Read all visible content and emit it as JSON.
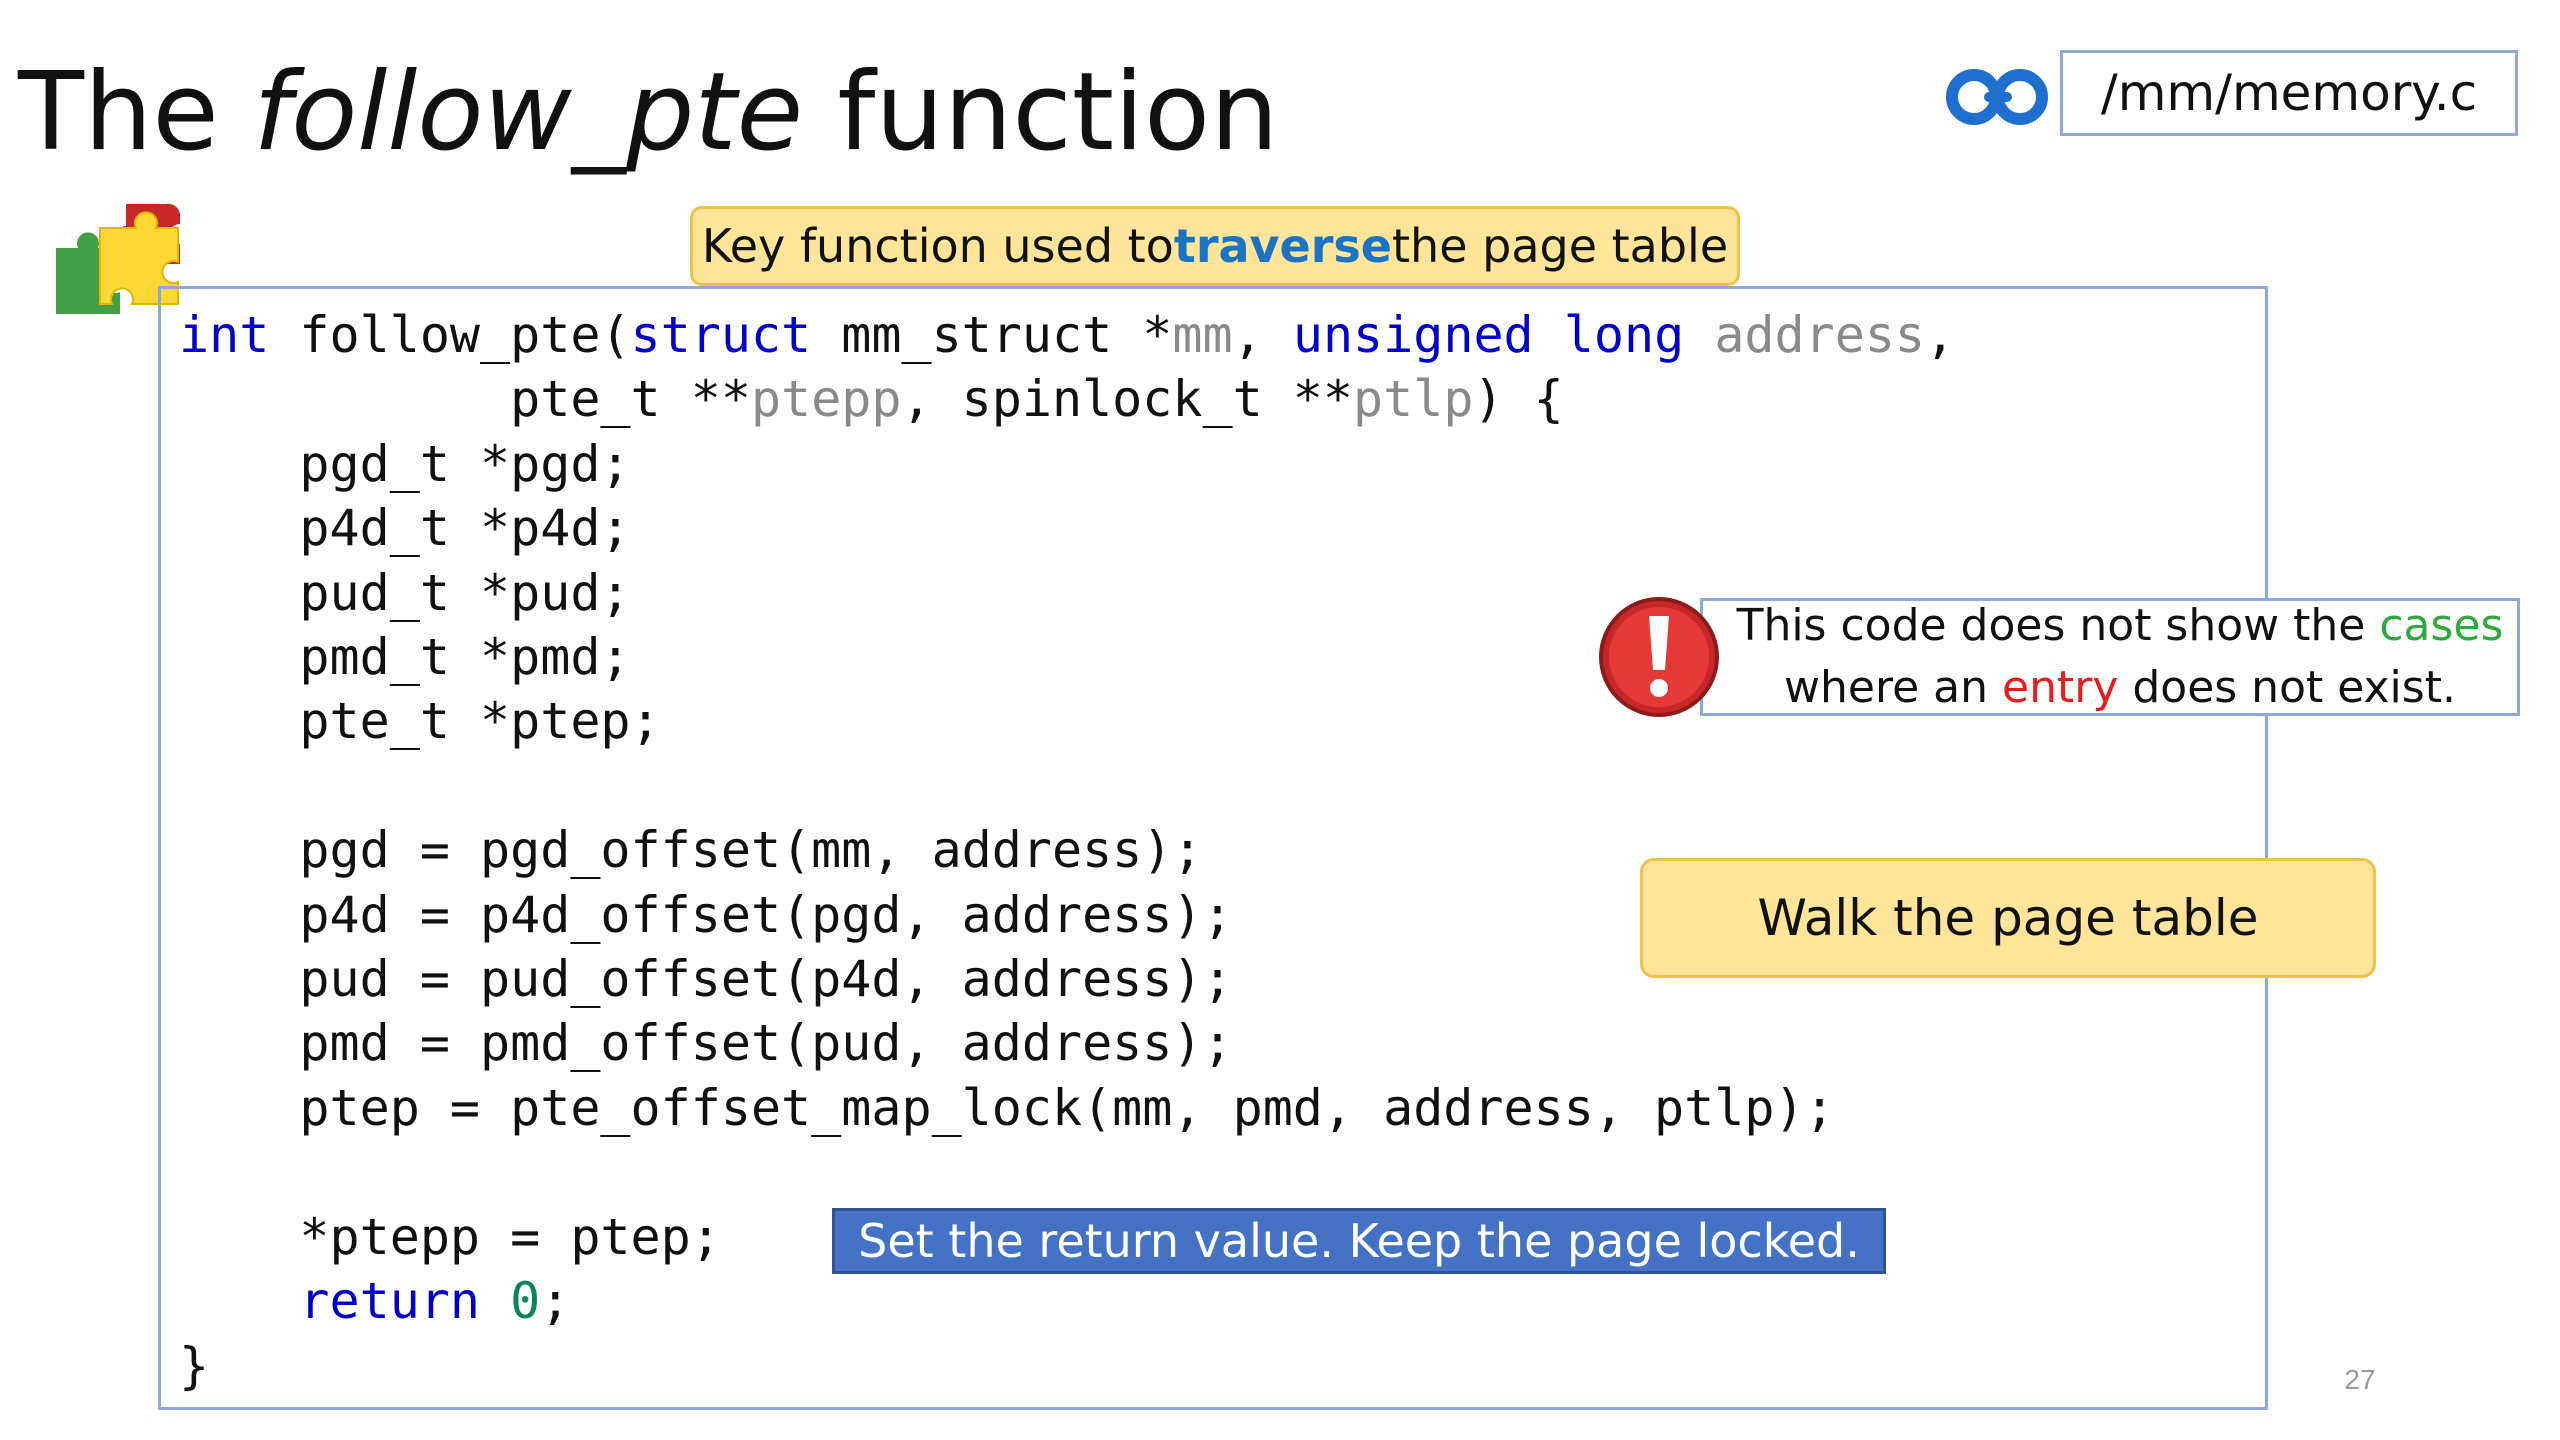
{
  "slide": {
    "title_prefix": "The ",
    "title_italic": "follow_pte",
    "title_suffix": " function",
    "file_path": "/mm/memory.c",
    "page_number": "27"
  },
  "callouts": {
    "key_function": {
      "before": "Key function used to ",
      "highlight": "traverse",
      "after": " the page table"
    },
    "note": {
      "line1_before": "This code does not show the ",
      "line1_highlight": "cases",
      "line2_before": "where an ",
      "line2_highlight": "entry",
      "line2_after": " does not exist."
    },
    "walk": "Walk the page table",
    "return_value": "Set the return value. Keep the page locked."
  },
  "code": {
    "l1_int": "int",
    "l1_fn": " follow_pte(",
    "l1_struct": "struct",
    "l1_mmstruct": " mm_struct *",
    "l1_mm": "mm",
    "l1_comma": ", ",
    "l1_unsigned": "unsigned",
    "l1_sp": " ",
    "l1_long": "long",
    "l1_sp2": " ",
    "l1_address": "address",
    "l1_end": ",",
    "l2_a": "           pte_t **",
    "l2_ptepp": "ptepp",
    "l2_b": ", spinlock_t **",
    "l2_ptlp": "ptlp",
    "l2_c": ") {",
    "l3": "    pgd_t *pgd;",
    "l4": "    p4d_t *p4d;",
    "l5": "    pud_t *pud;",
    "l6": "    pmd_t *pmd;",
    "l7": "    pte_t *ptep;",
    "l9": "    pgd = pgd_offset(mm, address);",
    "l10": "    p4d = p4d_offset(pgd, address);",
    "l11": "    pud = pud_offset(p4d, address);",
    "l12": "    pmd = pmd_offset(pud, address);",
    "l13": "    ptep = pte_offset_map_lock(mm, pmd, address, ptlp);",
    "l15": "    *ptepp = ptep;",
    "l16_indent": "    ",
    "l16_return": "return",
    "l16_sp": " ",
    "l16_zero": "0",
    "l16_end": ";",
    "l17": "}"
  },
  "icons": {
    "file_link": "chain-link-icon",
    "puzzle": "puzzle-pieces-icon",
    "warning": "exclamation-warning-icon"
  },
  "colors": {
    "keyword_blue": "#0000cc",
    "param_gray": "#8a8a8a",
    "number_green": "#098658",
    "highlight_blue": "#1b73c4",
    "callout_yellow": "#fee599",
    "callout_blue": "#4472c4",
    "cases_green": "#2eaa3a",
    "entry_red": "#e81c1c",
    "border_blue": "#8eaadb"
  }
}
